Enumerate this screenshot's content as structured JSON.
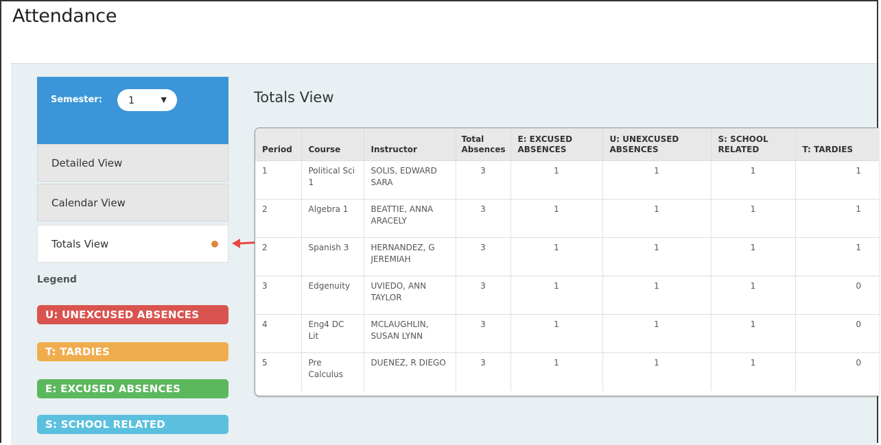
{
  "page": {
    "title": "Attendance"
  },
  "sidebar": {
    "semester_label": "Semester:",
    "semester_value": "1",
    "nav": [
      {
        "label": "Detailed View"
      },
      {
        "label": "Calendar View"
      },
      {
        "label": "Totals View"
      }
    ],
    "legend_title": "Legend",
    "legend": [
      {
        "label": "U: UNEXCUSED ABSENCES",
        "color": "#d9534f"
      },
      {
        "label": "T: TARDIES",
        "color": "#f0ad4e"
      },
      {
        "label": "E: EXCUSED ABSENCES",
        "color": "#5cb85c"
      },
      {
        "label": "S: SCHOOL RELATED",
        "color": "#5bc0de"
      }
    ]
  },
  "main": {
    "title": "Totals View",
    "columns": [
      "Period",
      "Course",
      "Instructor",
      "Total Absences",
      "E: EXCUSED ABSENCES",
      "U: UNEXCUSED ABSENCES",
      "S: SCHOOL RELATED",
      "T: TARDIES"
    ],
    "rows": [
      [
        "1",
        "Political Sci 1",
        "SOLIS, EDWARD SARA",
        "3",
        "1",
        "1",
        "1",
        "1"
      ],
      [
        "2",
        "Algebra 1",
        "BEATTIE, ANNA ARACELY",
        "3",
        "1",
        "1",
        "1",
        "1"
      ],
      [
        "2",
        "Spanish 3",
        "HERNANDEZ, G JEREMIAH",
        "3",
        "1",
        "1",
        "1",
        "1"
      ],
      [
        "3",
        "Edgenuity",
        "UVIEDO, ANN TAYLOR",
        "3",
        "1",
        "1",
        "1",
        "0"
      ],
      [
        "4",
        "Eng4 DC Lit",
        "MCLAUGHLIN, SUSAN LYNN",
        "3",
        "1",
        "1",
        "1",
        "0"
      ],
      [
        "5",
        "Pre Calculus",
        "DUENEZ, R DIEGO",
        "3",
        "1",
        "1",
        "1",
        "0"
      ]
    ]
  }
}
